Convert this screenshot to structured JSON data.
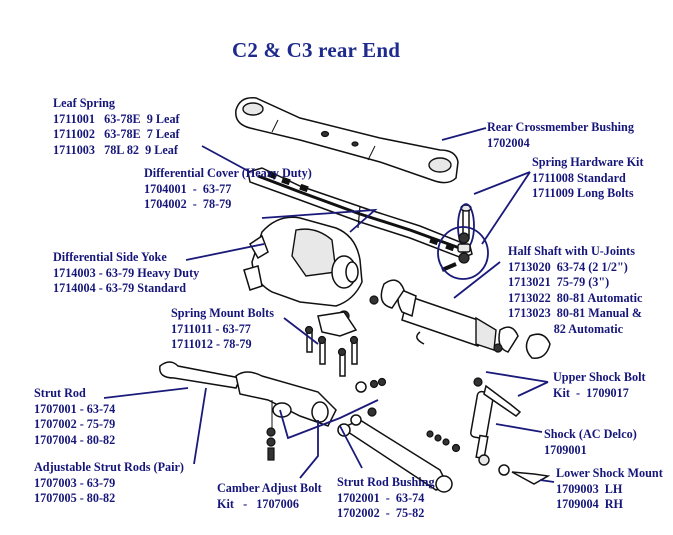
{
  "title": "C2 & C3 rear End",
  "colors": {
    "label_text": "#16167a",
    "title_text": "#1e2a8c",
    "leader_line": "#1a1a7a",
    "part_outline": "#111111",
    "background": "#ffffff"
  },
  "callouts": {
    "leaf_spring": {
      "heading": "Leaf Spring",
      "lines": [
        "1711001   63-78E  9 Leaf",
        "1711002   63-78E  7 Leaf",
        "1711003   78L 82  9 Leaf"
      ]
    },
    "rear_crossmember_bushing": {
      "heading": "Rear Crossmember Bushing",
      "lines": [
        "1702004"
      ]
    },
    "spring_hardware_kit": {
      "heading": "Spring Hardware Kit",
      "lines": [
        "1711008 Standard",
        "1711009 Long Bolts"
      ]
    },
    "differential_cover": {
      "heading": "Differential Cover (Heavy Duty)",
      "lines": [
        "1704001  -  63-77",
        "1704002  -  78-79"
      ]
    },
    "differential_side_yoke": {
      "heading": "Differential Side Yoke",
      "lines": [
        "1714003 - 63-79 Heavy Duty",
        "1714004 - 63-79 Standard"
      ]
    },
    "half_shaft": {
      "heading": "Half Shaft with U-Joints",
      "lines": [
        "1713020  63-74 (2 1/2\")",
        "1713021  75-79 (3\")",
        "1713022  80-81 Automatic",
        "1713023  80-81 Manual &",
        "               82 Automatic"
      ]
    },
    "spring_mount_bolts": {
      "heading": "Spring Mount Bolts",
      "lines": [
        "1711011 - 63-77",
        "1711012 - 78-79"
      ]
    },
    "strut_rod": {
      "heading": "Strut Rod",
      "lines": [
        "1707001 - 63-74",
        "1707002 - 75-79",
        "1707004 - 80-82"
      ]
    },
    "adjustable_strut_rods": {
      "heading": "Adjustable Strut Rods (Pair)",
      "lines": [
        "1707003 - 63-79",
        "1707005 - 80-82"
      ]
    },
    "camber_adjust_bolt": {
      "heading": "Camber Adjust Bolt",
      "lines": [
        "Kit   -   1707006"
      ]
    },
    "strut_rod_bushing": {
      "heading": "Strut Rod Bushing",
      "lines": [
        "1702001  -  63-74",
        "1702002  -  75-82"
      ]
    },
    "upper_shock_bolt": {
      "heading": "Upper Shock Bolt",
      "lines": [
        "Kit  -  1709017"
      ]
    },
    "shock": {
      "heading": "Shock (AC Delco)",
      "lines": [
        "1709001"
      ]
    },
    "lower_shock_mount": {
      "heading": "Lower Shock Mount",
      "lines": [
        "1709003  LH",
        "1709004  RH"
      ]
    }
  }
}
